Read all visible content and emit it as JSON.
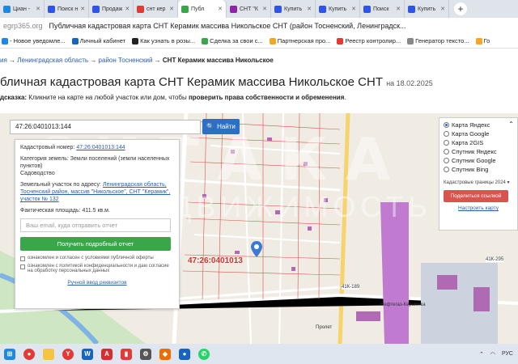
{
  "browser": {
    "tabs": [
      {
        "label": "Циан -",
        "color": "#1e88e5",
        "active": false
      },
      {
        "label": "Поиск н",
        "color": "#2f54eb",
        "active": false
      },
      {
        "label": "Продаж",
        "color": "#2f54eb",
        "active": false
      },
      {
        "label": "снт кер",
        "color": "#e53935",
        "active": false
      },
      {
        "label": "Публ",
        "color": "#3aa64a",
        "active": true
      },
      {
        "label": "СНТ \"К",
        "color": "#8e24aa",
        "active": false
      },
      {
        "label": "Купить",
        "color": "#2f54eb",
        "active": false
      },
      {
        "label": "Купить",
        "color": "#2f54eb",
        "active": false
      },
      {
        "label": "Поиск",
        "color": "#2f54eb",
        "active": false
      },
      {
        "label": "Купить",
        "color": "#2f54eb",
        "active": false
      }
    ],
    "new_tab": "+",
    "address_host": "egrp365.org",
    "address_title": "Публичная кадастровая карта СНТ Керамик массива Никольское СНТ (район Тосненский, Ленинградск...",
    "bookmarks": [
      {
        "label": "- Новое уведомле...",
        "color": "#1e88e5"
      },
      {
        "label": "Личный кабинет",
        "color": "#1565c0"
      },
      {
        "label": "Как узнать в розы...",
        "color": "#222"
      },
      {
        "label": "Сделка за свои с...",
        "color": "#3aa64a"
      },
      {
        "label": "Партнерская про...",
        "color": "#f5a623"
      },
      {
        "label": "Реестр контролир...",
        "color": "#e53935"
      },
      {
        "label": "Генератор тексто...",
        "color": "#888"
      },
      {
        "label": "Го",
        "color": "#f5a623"
      }
    ]
  },
  "breadcrumb": {
    "items": [
      "ия",
      "Ленинградская область",
      "район Тосненский"
    ],
    "separator": "→",
    "current": "СНТ Керамик массива Никольское"
  },
  "page": {
    "title": "бличная кадастровая карта СНТ Керамик массива Никольское СНТ",
    "date": "на 18.02.2025",
    "hint_prefix": "дсказка:",
    "hint_text": " Кликните на карте на любой участок или дом, чтобы ",
    "hint_bold": "проверить права собственности и обременения",
    "hint_end": "."
  },
  "search": {
    "value": "47:26:0401013:144",
    "button_label": "Найти"
  },
  "info_panel": {
    "cadastral_label": "Кадастровый номер:",
    "cadastral_value": "47:26:0401013:144",
    "category_label": "Категория земель:",
    "category_value": "Земли поселений (земли населенных пунктов)",
    "use": "Садоводство",
    "address_label": "Земельный участок по адресу:",
    "address_value": "Ленинградская область, Тосненский район, массив \"Никольское\", СНТ \"Керамик\", участок № 132",
    "area_label": "Фактическая площадь:",
    "area_value": "411.5 кв.м.",
    "email_placeholder": "Ваш email, куда отправить отчет",
    "order_button": "Получить подробный отчет",
    "consent1": "ознакомлен и согласен с условиями публичной оферты",
    "consent2": "ознакомлен с политикой конфиденциальности и даю согласие на обработку персональных данных",
    "manual_link": "Ручной ввод реквизитов"
  },
  "layers": {
    "options": [
      {
        "label": "Карта Яндекс",
        "selected": true
      },
      {
        "label": "Карта Google",
        "selected": false
      },
      {
        "label": "Карта 2GIS",
        "selected": false
      },
      {
        "label": "Спутник Яндекс",
        "selected": false
      },
      {
        "label": "Спутник Google",
        "selected": false
      },
      {
        "label": "Спутник Bing",
        "selected": false
      }
    ],
    "borders": "Кадастровые границы 2024 ▾",
    "share_button": "Поделиться ссылкой",
    "fullscreen_link": "Настроить карту"
  },
  "map": {
    "parcel_label": "47:26:0401013",
    "watermark_top": "СИТАКА",
    "watermark_bottom": "НЕДВИЖИМОСТЬ",
    "labels": [
      "Нефтегаз-Керамика",
      "Пролет",
      "41К-189",
      "41К-295"
    ]
  },
  "taskbar": {
    "tray_lang": "РУС"
  }
}
